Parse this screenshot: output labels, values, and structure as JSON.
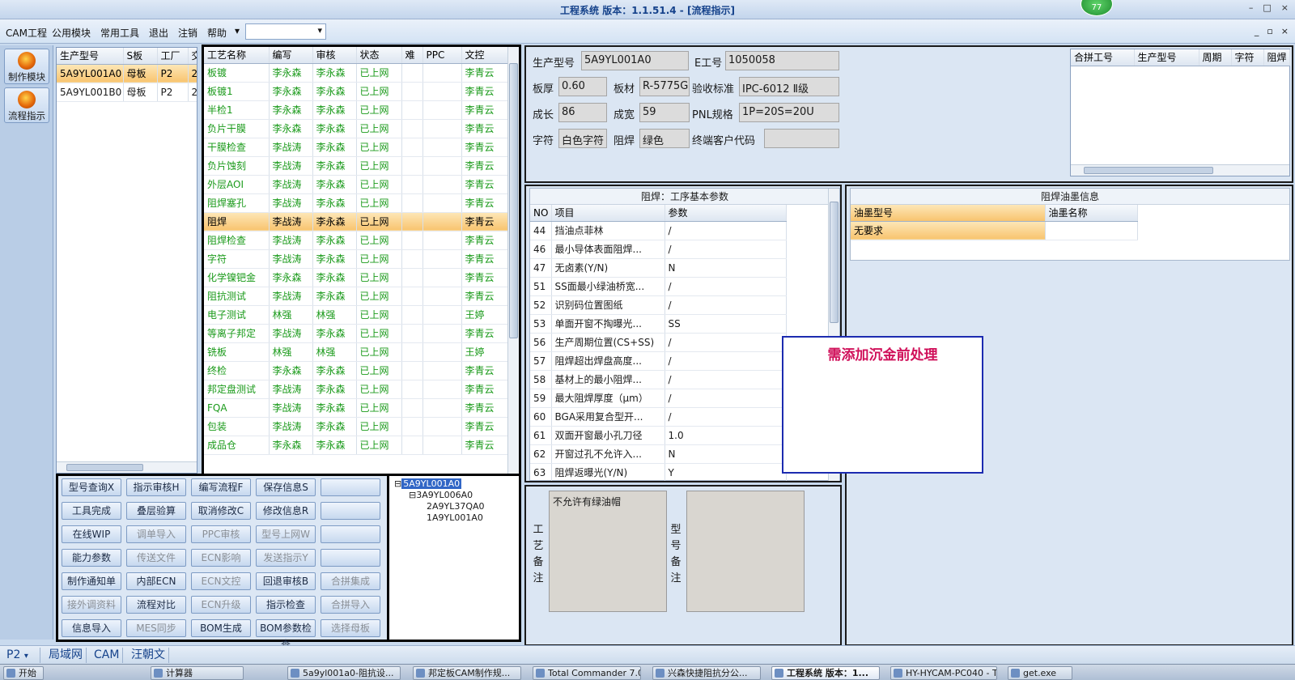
{
  "window": {
    "title": "工程系统  版本：1.1.51.4 - [流程指示]",
    "badge": "77",
    "controls": [
      "–",
      "□",
      "×"
    ],
    "mdi_controls": [
      "_",
      "▫",
      "×"
    ]
  },
  "menu": [
    "CAM工程",
    "公用模块",
    "常用工具",
    "退出",
    "注销",
    "帮助"
  ],
  "nav": [
    {
      "label": "制作模块",
      "icon": "fire-icon"
    },
    {
      "label": "流程指示",
      "icon": "fire-icon"
    }
  ],
  "model_list": {
    "headers": [
      "生产型号",
      "S板",
      "工厂",
      "交"
    ],
    "rows": [
      [
        "5A9YL001A0",
        "母板",
        "P2",
        "2("
      ],
      [
        "5A9YL001B0",
        "母板",
        "P2",
        "2("
      ]
    ]
  },
  "process": {
    "headers": [
      "工艺名称",
      "编写",
      "审核",
      "状态",
      "难",
      "PPC",
      "文控"
    ],
    "rows": [
      [
        "板镀",
        "李永森",
        "李永森",
        "已上网",
        "",
        "",
        "李青云"
      ],
      [
        "板镀1",
        "李永森",
        "李永森",
        "已上网",
        "",
        "",
        "李青云"
      ],
      [
        "半检1",
        "李永森",
        "李永森",
        "已上网",
        "",
        "",
        "李青云"
      ],
      [
        "负片干膜",
        "李永森",
        "李永森",
        "已上网",
        "",
        "",
        "李青云"
      ],
      [
        "干膜检查",
        "李战涛",
        "李永森",
        "已上网",
        "",
        "",
        "李青云"
      ],
      [
        "负片蚀刻",
        "李战涛",
        "李永森",
        "已上网",
        "",
        "",
        "李青云"
      ],
      [
        "外层AOI",
        "李战涛",
        "李永森",
        "已上网",
        "",
        "",
        "李青云"
      ],
      [
        "阻焊塞孔",
        "李战涛",
        "李永森",
        "已上网",
        "",
        "",
        "李青云"
      ],
      [
        "阻焊",
        "李战涛",
        "李永森",
        "已上网",
        "",
        "",
        "李青云"
      ],
      [
        "阻焊检查",
        "李战涛",
        "李永森",
        "已上网",
        "",
        "",
        "李青云"
      ],
      [
        "字符",
        "李战涛",
        "李永森",
        "已上网",
        "",
        "",
        "李青云"
      ],
      [
        "化学镍钯金",
        "李永森",
        "李永森",
        "已上网",
        "",
        "",
        "李青云"
      ],
      [
        "阻抗测试",
        "李战涛",
        "李永森",
        "已上网",
        "",
        "",
        "李青云"
      ],
      [
        "电子测试",
        "林强",
        "林强",
        "已上网",
        "",
        "",
        "王婷"
      ],
      [
        "等离子邦定",
        "李战涛",
        "李永森",
        "已上网",
        "",
        "",
        "李青云"
      ],
      [
        "铣板",
        "林强",
        "林强",
        "已上网",
        "",
        "",
        "王婷"
      ],
      [
        "终检",
        "李永森",
        "李永森",
        "已上网",
        "",
        "",
        "李青云"
      ],
      [
        "邦定盘测试",
        "李战涛",
        "李永森",
        "已上网",
        "",
        "",
        "李青云"
      ],
      [
        "FQA",
        "李战涛",
        "李永森",
        "已上网",
        "",
        "",
        "李青云"
      ],
      [
        "包装",
        "李战涛",
        "李永森",
        "已上网",
        "",
        "",
        "李青云"
      ],
      [
        "成品仓",
        "李永森",
        "李永森",
        "已上网",
        "",
        "",
        "李青云"
      ]
    ]
  },
  "buttons": [
    [
      "型号查询X",
      "指示审核H",
      "编写流程F",
      "保存信息S",
      ""
    ],
    [
      "工具完成",
      "叠层验算",
      "取消修改C",
      "修改信息R",
      ""
    ],
    [
      "在线WIP",
      "调单导入",
      "PPC审核",
      "型号上网W",
      ""
    ],
    [
      "能力参数",
      "传送文件",
      "ECN影响",
      "发送指示Y",
      ""
    ],
    [
      "制作通知单",
      "内部ECN",
      "ECN文控",
      "回退审核B",
      "合拼集成"
    ],
    [
      "接外调资料",
      "流程对比",
      "ECN升级",
      "指示检查",
      "合拼导入"
    ],
    [
      "信息导入",
      "MES同步",
      "BOM生成",
      "BOM参数检查",
      "选择母板"
    ]
  ],
  "tree": [
    "5A9YL001A0",
    "3A9YL006A0",
    "2A9YL37QA0",
    "1A9YL001A0"
  ],
  "info": {
    "fields": [
      {
        "label": "生产型号",
        "value": "5A9YL001A0"
      },
      {
        "label": "E工号",
        "value": "1050058"
      },
      {
        "label": "板厚",
        "value": "0.60"
      },
      {
        "label": "板材",
        "value": "R-5775G"
      },
      {
        "label": "验收标准",
        "value": "IPC-6012 Ⅱ级"
      },
      {
        "label": "成长",
        "value": "86"
      },
      {
        "label": "成宽",
        "value": "59"
      },
      {
        "label": "PNL规格",
        "value": "1P=20S=20U"
      },
      {
        "label": "字符",
        "value": "白色字符"
      },
      {
        "label": "阻焊",
        "value": "绿色"
      },
      {
        "label": "终端客户代码",
        "value": ""
      }
    ]
  },
  "merge_table": {
    "headers": [
      "合拼工号",
      "生产型号",
      "周期",
      "字符",
      "阻焊"
    ]
  },
  "params": {
    "title": "阻焊：工序基本参数",
    "headers": [
      "NO",
      "项目",
      "参数"
    ],
    "rows": [
      [
        "44",
        "挡油点菲林",
        "/"
      ],
      [
        "46",
        "最小导体表面阻焊...",
        "/"
      ],
      [
        "47",
        "无卤素(Y/N)",
        "N"
      ],
      [
        "51",
        "SS面最小绿油桥宽...",
        "/"
      ],
      [
        "52",
        "识别码位置图纸",
        "/"
      ],
      [
        "53",
        "单面开窗不掏曝光...",
        "SS"
      ],
      [
        "56",
        "生产周期位置(CS+SS)",
        "/"
      ],
      [
        "57",
        "阻焊超出焊盘高度...",
        "/"
      ],
      [
        "58",
        "基材上的最小阻焊...",
        "/"
      ],
      [
        "59",
        "最大阻焊厚度（μm）",
        "/"
      ],
      [
        "60",
        "BGA采用复合型开...",
        "/"
      ],
      [
        "61",
        "双面开窗最小孔刀径",
        "1.0"
      ],
      [
        "62",
        "开窗过孔不允许入...",
        "N"
      ],
      [
        "63",
        "阻焊返曝光(Y/N)",
        "Y"
      ]
    ]
  },
  "ink": {
    "title": "阻焊油墨信息",
    "headers": [
      "油墨型号",
      "油墨名称"
    ],
    "rows": [
      [
        "无要求",
        ""
      ]
    ]
  },
  "popup_note": "需添加沉金前处理",
  "remarks": {
    "process_label": "工艺备注",
    "process_text": "不允许有绿油帽",
    "model_label": "型号备注",
    "model_text": ""
  },
  "status": {
    "plant": "P2",
    "tabs": [
      "局域网",
      "CAM",
      "汪朝文"
    ]
  },
  "taskbar": [
    {
      "label": "开始",
      "active": false
    },
    {
      "label": "计算器",
      "active": false
    },
    {
      "label": "5a9yl001a0-阻抗设...",
      "active": false
    },
    {
      "label": "邦定板CAM制作规...",
      "active": false
    },
    {
      "label": "Total Commander 7.0...",
      "active": false
    },
    {
      "label": "兴森快捷阻抗分公...",
      "active": false
    },
    {
      "label": "工程系统  版本：1...",
      "active": true
    },
    {
      "label": "HY-HYCAM-PC040 - T...",
      "active": false
    },
    {
      "label": "get.exe",
      "active": false
    }
  ],
  "colors": {
    "green_text": "#1a9a1a",
    "selected_row": "#f8c46f",
    "popup_border": "#1c2bb0",
    "popup_text": "#d0105a"
  }
}
